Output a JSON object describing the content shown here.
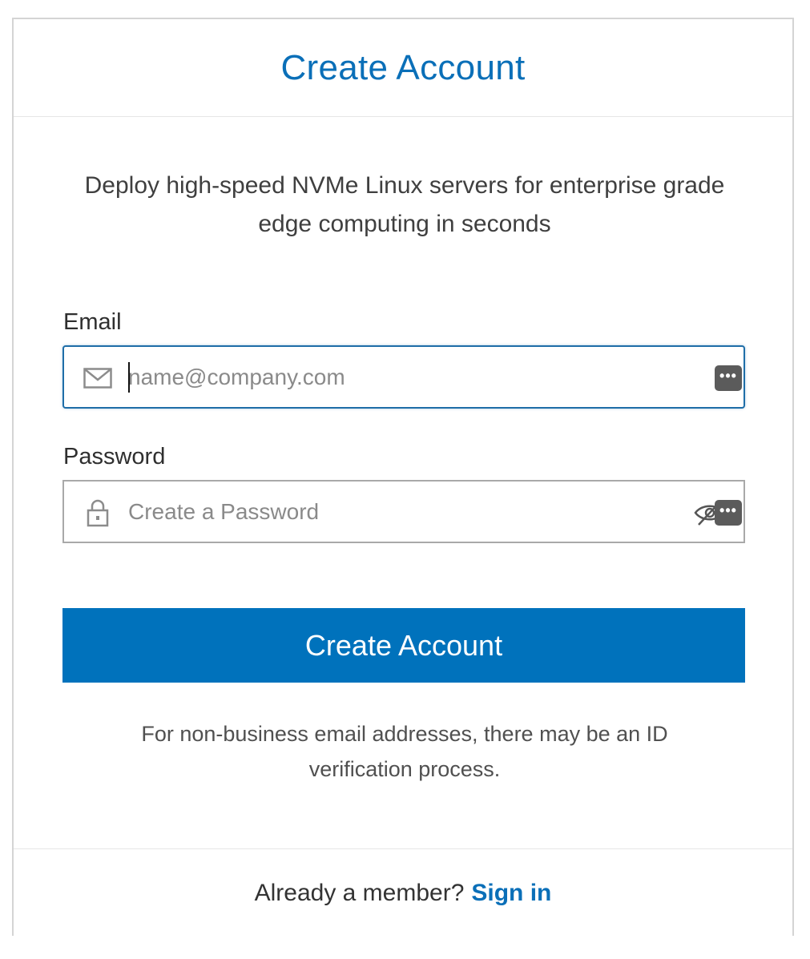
{
  "header": {
    "title": "Create Account"
  },
  "intro": {
    "subtitle": "Deploy high-speed NVMe Linux servers for enterprise grade edge computing in seconds"
  },
  "form": {
    "email": {
      "label": "Email",
      "placeholder": "name@company.com",
      "value": "",
      "icon": "envelope-icon"
    },
    "password": {
      "label": "Password",
      "placeholder": "Create a Password",
      "value": "",
      "icon": "lock-icon",
      "toggle_icon": "eye-slash-icon"
    },
    "password_manager_icon": "password-manager-icon",
    "submit_label": "Create Account",
    "note": "For non-business email addresses, there may be an ID verification process."
  },
  "footer": {
    "prompt": "Already a member?",
    "link_label": "Sign in"
  },
  "colors": {
    "accent": "#0072bc",
    "title": "#0a6fb8",
    "focus_border": "#1f6ea8"
  }
}
